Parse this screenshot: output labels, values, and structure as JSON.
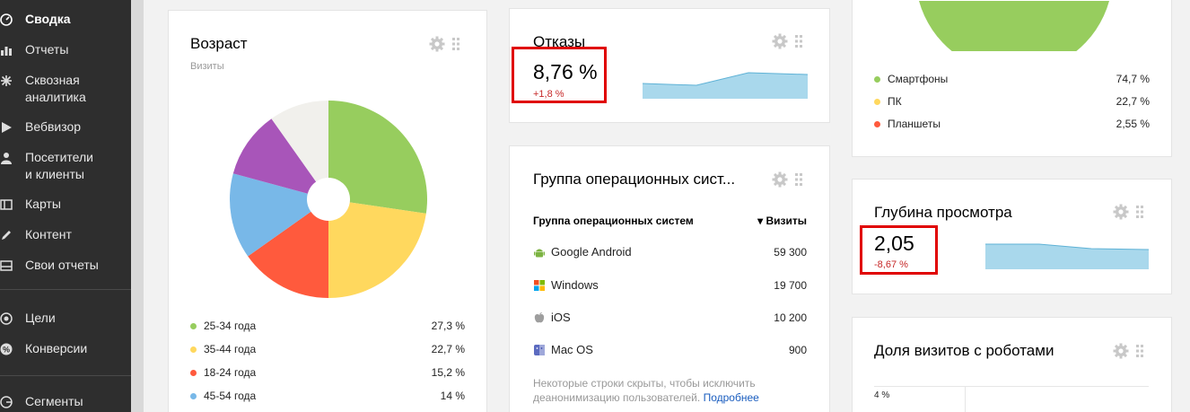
{
  "sidebar": {
    "items": [
      {
        "label": "Сводка",
        "icon": "gauge-icon"
      },
      {
        "label": "Отчеты",
        "icon": "bar-chart-icon"
      },
      {
        "label_line1": "Сквозная",
        "label_line2": "аналитика",
        "icon": "sparkle-icon"
      },
      {
        "label": "Вебвизор",
        "icon": "play-icon"
      },
      {
        "label_line1": "Посетители",
        "label_line2": "и клиенты",
        "icon": "person-icon"
      },
      {
        "label": "Карты",
        "icon": "map-icon"
      },
      {
        "label": "Контент",
        "icon": "pencil-icon"
      },
      {
        "label": "Свои отчеты",
        "icon": "tray-icon"
      },
      {
        "label": "Цели",
        "icon": "target-icon"
      },
      {
        "label": "Конверсии",
        "icon": "percent-icon"
      },
      {
        "label": "Сегменты",
        "icon": "segments-icon"
      }
    ]
  },
  "age_card": {
    "title": "Возраст",
    "subtitle": "Визиты",
    "legend": [
      {
        "label": "25-34 года",
        "value": "27,3 %",
        "color": "#97cd5e"
      },
      {
        "label": "35-44 года",
        "value": "22,7 %",
        "color": "#ffd85e"
      },
      {
        "label": "18-24 года",
        "value": "15,2 %",
        "color": "#ff5a3d"
      },
      {
        "label": "45-54 года",
        "value": "14 %",
        "color": "#78b8e8"
      }
    ]
  },
  "chart_data": {
    "type": "pie",
    "title": "Возраст",
    "categories": [
      "25-34 года",
      "35-44 года",
      "18-24 года",
      "45-54 года",
      "",
      ""
    ],
    "values": [
      27.3,
      22.7,
      15.2,
      14,
      11,
      9.8
    ],
    "colors": [
      "#97cd5e",
      "#ffd85e",
      "#ff5a3d",
      "#78b8e8",
      "#a855b9",
      "#f1f0ec"
    ]
  },
  "bounce_card": {
    "title": "Отказы",
    "value": "8,76 %",
    "delta": "+1,8 %"
  },
  "os_card": {
    "title": "Группа операционных сист...",
    "col_name": "Группа операционных систем",
    "col_visits": "▾ Визиты",
    "rows": [
      {
        "name": "Google Android",
        "value": "59 300"
      },
      {
        "name": "Windows",
        "value": "19 700"
      },
      {
        "name": "iOS",
        "value": "10 200"
      },
      {
        "name": "Mac OS",
        "value": "900"
      }
    ],
    "note_text": "Некоторые строки скрыты, чтобы исключить деанонимизацию пользователей.",
    "note_link": "Подробнее"
  },
  "devices_card": {
    "legend": [
      {
        "label": "Смартфоны",
        "value": "74,7 %",
        "color": "#97cd5e"
      },
      {
        "label": "ПК",
        "value": "22,7 %",
        "color": "#ffd85e"
      },
      {
        "label": "Планшеты",
        "value": "2,55 %",
        "color": "#ff5a3d"
      }
    ]
  },
  "depth_card": {
    "title": "Глубина просмотра",
    "value": "2,05",
    "delta": "-8,67 %"
  },
  "robots_card": {
    "title": "Доля визитов с роботами",
    "tick": "4 %"
  },
  "colors": {
    "sidebar_bg": "#2e2e2e",
    "sparkline": "#a9d8ec",
    "highlight": "#e00000",
    "delta_red": "#c62828"
  }
}
